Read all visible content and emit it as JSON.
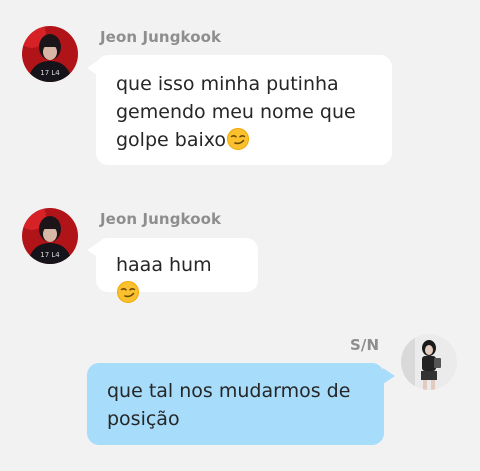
{
  "messages": [
    {
      "sender": "Jeon Jungkook",
      "lines": [
        "que isso minha putinha",
        "gemendo meu nome que",
        "golpe baixo"
      ],
      "emoji": "smirking-face-icon",
      "direction": "incoming"
    },
    {
      "sender": "Jeon Jungkook",
      "lines": [
        "haaa hum "
      ],
      "emoji": "smirking-face-icon",
      "direction": "incoming"
    },
    {
      "sender": "S/N",
      "lines": [
        "que tal nos mudarmos de",
        "posição"
      ],
      "direction": "outgoing"
    }
  ],
  "colors": {
    "background": "#f2f2f2",
    "incoming_bubble": "#ffffff",
    "outgoing_bubble": "#a7dcfb",
    "sender_name": "#8e8e8e",
    "text": "#262626"
  }
}
